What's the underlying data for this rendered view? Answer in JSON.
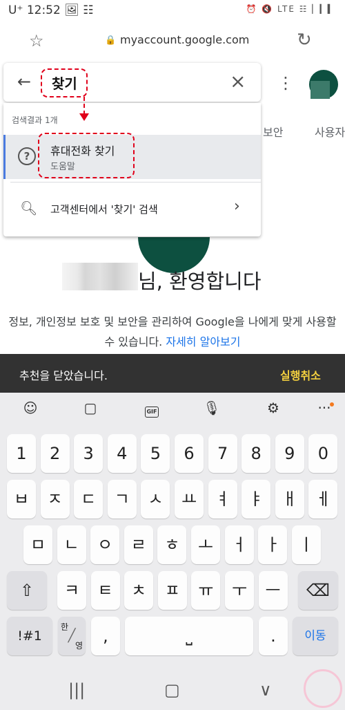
{
  "status_bar": {
    "left": "U⁺ 12:52 🖼 ☷",
    "right": "⏰ 🔇 LTE ☷ ▏▎▍"
  },
  "browser": {
    "url": "myaccount.google.com"
  },
  "search": {
    "query": "찾기",
    "result_count": "검색결과 1개",
    "result_title": "휴대전화 찾기",
    "result_subtitle": "도움말",
    "help_center_search": "고객센터에서 '찾기' 검색"
  },
  "page": {
    "tab_security": "보안",
    "tab_users": "사용자",
    "welcome": "님, 환영합니다",
    "description": "정보, 개인정보 보호 및 보안을 관리하여 Google을 나에게 맞게 사용할 수 있습니다.",
    "learn_more": "자세히 알아보기"
  },
  "snackbar": {
    "message": "추천을 닫았습니다.",
    "action": "실행취소"
  },
  "keyboard": {
    "toolbar": [
      "emoji-icon",
      "sticker-icon",
      "gif-icon",
      "mic-icon",
      "gear-icon",
      "more-icon"
    ],
    "row_numbers": [
      "1",
      "2",
      "3",
      "4",
      "5",
      "6",
      "7",
      "8",
      "9",
      "0"
    ],
    "row1": [
      "ㅂ",
      "ㅈ",
      "ㄷ",
      "ㄱ",
      "ㅅ",
      "ㅛ",
      "ㅕ",
      "ㅑ",
      "ㅐ",
      "ㅔ"
    ],
    "row2": [
      "ㅁ",
      "ㄴ",
      "ㅇ",
      "ㄹ",
      "ㅎ",
      "ㅗ",
      "ㅓ",
      "ㅏ",
      "ㅣ"
    ],
    "row3": [
      "ㅋ",
      "ㅌ",
      "ㅊ",
      "ㅍ",
      "ㅠ",
      "ㅜ",
      "ㅡ"
    ],
    "symbols": "!#1",
    "lang_top": "한",
    "lang_bottom": "영",
    "comma": ",",
    "period": ".",
    "enter": "이동"
  },
  "colors": {
    "accent": "#1a73e8",
    "annotation": "#e0001b",
    "snackbar_action": "#f4d03f"
  }
}
